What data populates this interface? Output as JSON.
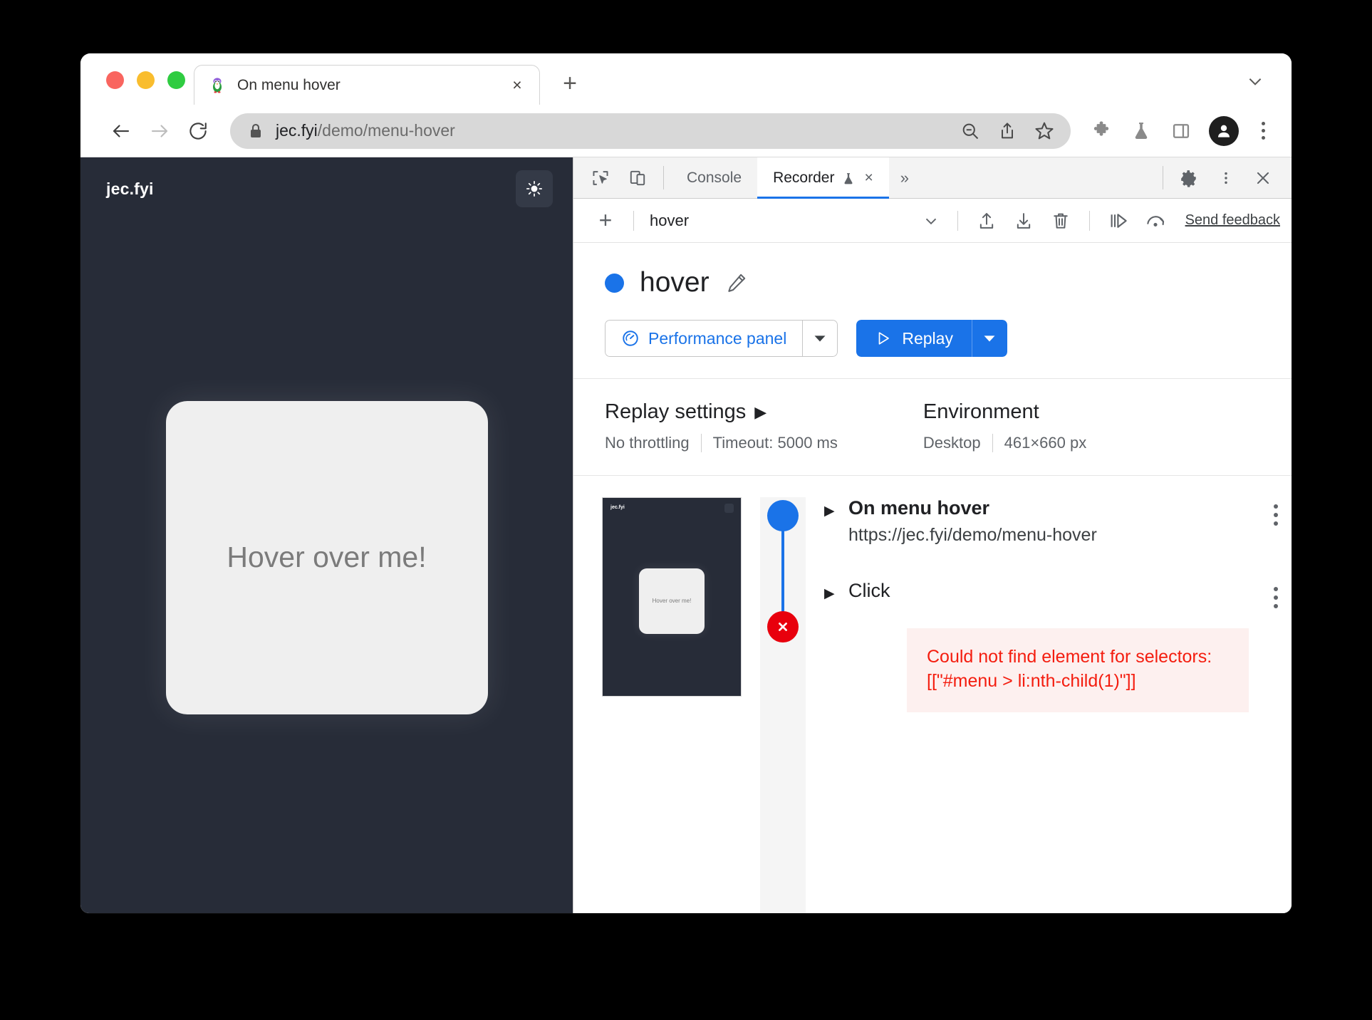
{
  "window": {
    "traffic_lights": [
      "close",
      "minimize",
      "zoom"
    ],
    "tab": {
      "title": "On menu hover",
      "favicon": "penguin-favicon",
      "close_label": "×"
    },
    "new_tab_label": "+",
    "tab_search_icon": "chevron-down-icon"
  },
  "omnibox": {
    "host": "jec.fyi",
    "path": "/demo/menu-hover",
    "lock_icon": "lock-icon",
    "actions": [
      "zoom-out-icon",
      "share-icon",
      "bookmark-star-icon"
    ],
    "toolbar_icons": [
      "extensions-puzzle-icon",
      "experiments-flask-icon",
      "side-panel-icon"
    ],
    "profile_icon": "profile-avatar-icon",
    "menu_icon": "browser-menu-icon",
    "back_icon": "back-arrow-icon",
    "forward_icon": "forward-arrow-icon",
    "reload_icon": "reload-icon"
  },
  "page": {
    "logo": "jec.fyi",
    "theme_toggle_icon": "sun-icon",
    "card_text": "Hover over me!",
    "background_color": "#272c38",
    "card_color": "#efefef"
  },
  "devtools": {
    "tabs": [
      {
        "label": "Console",
        "active": false
      },
      {
        "label": "Recorder",
        "active": true,
        "icon": "experiments-flask-icon",
        "closable": true
      }
    ],
    "inspect_icon": "inspect-element-icon",
    "device_toggle_icon": "device-toolbar-icon",
    "overflow_label": "»",
    "settings_icon": "gear-icon",
    "more_icon": "more-options-icon",
    "close_icon": "close-icon",
    "close_tab_label": "×"
  },
  "recorder_toolbar": {
    "add_label": "+",
    "selected_recording": "hover",
    "dropdown_icon": "chevron-down-icon",
    "import_icon": "import-icon",
    "export_icon": "export-icon",
    "delete_icon": "delete-icon",
    "step_by_step_icon": "replay-step-icon",
    "replay_speed_icon": "replay-speed-icon",
    "feedback_label": "Send feedback"
  },
  "recording": {
    "status_dot_color": "#1a73e8",
    "name": "hover",
    "edit_icon": "pencil-edit-icon",
    "performance_button": {
      "label": "Performance panel",
      "icon": "performance-gauge-icon",
      "dropdown_icon": "chevron-down-icon"
    },
    "replay_button": {
      "label": "Replay",
      "icon": "play-icon",
      "dropdown_icon": "chevron-down-icon"
    }
  },
  "settings": {
    "replay": {
      "title": "Replay settings",
      "expand_icon": "▶",
      "throttling": "No throttling",
      "timeout": "Timeout: 5000 ms"
    },
    "environment": {
      "title": "Environment",
      "device": "Desktop",
      "viewport": "461×660 px"
    }
  },
  "thumbnail": {
    "logo": "jec.fyi",
    "card_text": "Hover over me!"
  },
  "steps": [
    {
      "name": "On menu hover",
      "url": "https://jec.fyi/demo/menu-hover",
      "status": "success",
      "caret": "▶",
      "menu_icon": "step-options-icon"
    },
    {
      "name": "Click",
      "url": "",
      "status": "error",
      "caret": "▶",
      "menu_icon": "step-options-icon"
    }
  ],
  "error": {
    "line1": "Could not find element for selectors:",
    "line2": "[[\"#menu > li:nth-child(1)\"]]",
    "color": "#f41d0f",
    "background": "#fdf0ef"
  }
}
